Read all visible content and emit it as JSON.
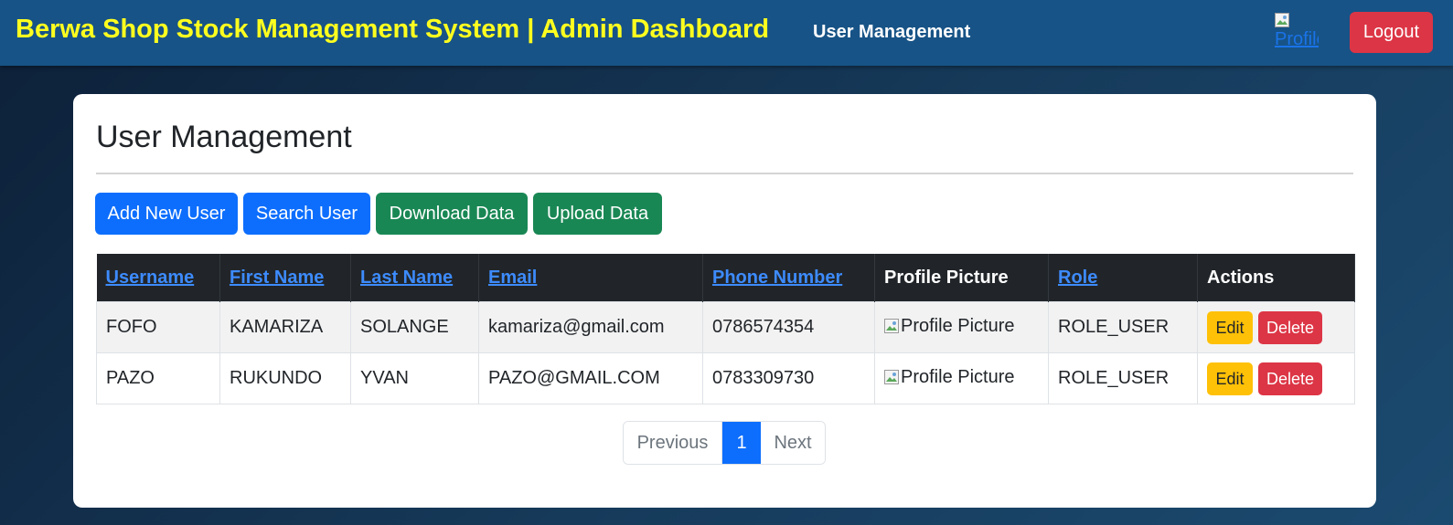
{
  "header": {
    "brand": "Berwa Shop Stock Management System | Admin Dashboard",
    "nav_link": "User Management",
    "profile_alt": "Profile",
    "logout": "Logout"
  },
  "main": {
    "title": "User Management",
    "buttons": {
      "add": "Add New User",
      "search": "Search User",
      "download": "Download Data",
      "upload": "Upload Data"
    },
    "table": {
      "headers": [
        "Username",
        "First Name",
        "Last Name",
        "Email",
        "Phone Number",
        "Profile Picture",
        "Role",
        "Actions"
      ],
      "rows": [
        {
          "username": "FOFO",
          "first": "KAMARIZA",
          "last": "SOLANGE",
          "email": "kamariza@gmail.com",
          "phone": "0786574354",
          "picture_alt": "Profile Picture",
          "role": "ROLE_USER"
        },
        {
          "username": "PAZO",
          "first": "RUKUNDO",
          "last": "YVAN",
          "email": "PAZO@GMAIL.COM",
          "phone": "0783309730",
          "picture_alt": "Profile Picture",
          "role": "ROLE_USER"
        }
      ],
      "actions": {
        "edit": "Edit",
        "delete": "Delete"
      }
    },
    "pagination": {
      "previous": "Previous",
      "current": "1",
      "next": "Next"
    }
  },
  "colors": {
    "header_bg": "#175386",
    "brand_text": "#ffff1f",
    "primary": "#0d6efd",
    "success": "#198754",
    "danger": "#dc3545",
    "warning": "#ffc107",
    "table_header": "#212529"
  }
}
